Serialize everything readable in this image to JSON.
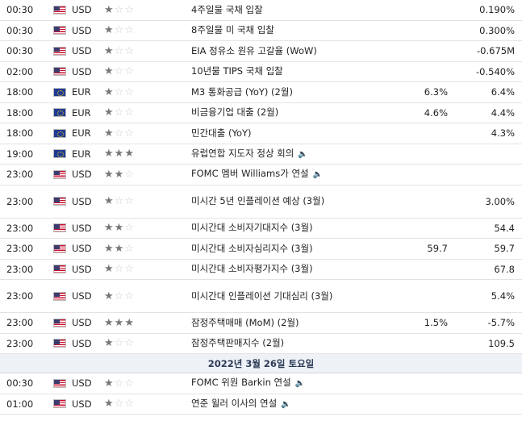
{
  "date_header": "2022년 3월 26일 토요일",
  "rows_before": [
    {
      "time": "00:30",
      "currency": "USD",
      "importance": 1,
      "event": "4주일물 국채 입찰",
      "actual": "",
      "forecast": "0.190%",
      "tall": false,
      "speech": false
    },
    {
      "time": "00:30",
      "currency": "USD",
      "importance": 1,
      "event": "8주일물 미 국채 입찰",
      "actual": "",
      "forecast": "0.300%",
      "tall": false,
      "speech": false
    },
    {
      "time": "00:30",
      "currency": "USD",
      "importance": 1,
      "event": "EIA 정유소 원유 고갈율 (WoW)",
      "actual": "",
      "forecast": "-0.675M",
      "tall": false,
      "speech": false
    },
    {
      "time": "02:00",
      "currency": "USD",
      "importance": 1,
      "event": "10년물 TIPS 국채 입찰",
      "actual": "",
      "forecast": "-0.540%",
      "tall": false,
      "speech": false
    },
    {
      "time": "18:00",
      "currency": "EUR",
      "importance": 1,
      "event": "M3 통화공급 (YoY) (2월)",
      "actual": "6.3%",
      "forecast": "6.4%",
      "tall": false,
      "speech": false
    },
    {
      "time": "18:00",
      "currency": "EUR",
      "importance": 1,
      "event": "비금융기업 대출 (2월)",
      "actual": "4.6%",
      "forecast": "4.4%",
      "tall": false,
      "speech": false
    },
    {
      "time": "18:00",
      "currency": "EUR",
      "importance": 1,
      "event": "민간대출 (YoY)",
      "actual": "",
      "forecast": "4.3%",
      "tall": false,
      "speech": false
    },
    {
      "time": "19:00",
      "currency": "EUR",
      "importance": 3,
      "event": "유럽연합 지도자 정상 회의",
      "actual": "",
      "forecast": "",
      "tall": false,
      "speech": true
    },
    {
      "time": "23:00",
      "currency": "USD",
      "importance": 2,
      "event": "FOMC 멤버 Williams가 연설",
      "actual": "",
      "forecast": "",
      "tall": false,
      "speech": true
    },
    {
      "time": "23:00",
      "currency": "USD",
      "importance": 1,
      "event": "미시간 5년 인플레이션 예상 (3월)",
      "actual": "",
      "forecast": "3.00%",
      "tall": true,
      "speech": false
    },
    {
      "time": "23:00",
      "currency": "USD",
      "importance": 2,
      "event": "미시간대 소비자기대지수 (3월)",
      "actual": "",
      "forecast": "54.4",
      "tall": false,
      "speech": false
    },
    {
      "time": "23:00",
      "currency": "USD",
      "importance": 2,
      "event": "미시간대 소비자심리지수 (3월)",
      "actual": "59.7",
      "forecast": "59.7",
      "tall": false,
      "speech": false
    },
    {
      "time": "23:00",
      "currency": "USD",
      "importance": 1,
      "event": "미시간대 소비자평가지수 (3월)",
      "actual": "",
      "forecast": "67.8",
      "tall": false,
      "speech": false
    },
    {
      "time": "23:00",
      "currency": "USD",
      "importance": 1,
      "event": "미시간대 인플레이션 기대심리 (3월)",
      "actual": "",
      "forecast": "5.4%",
      "tall": true,
      "speech": false
    },
    {
      "time": "23:00",
      "currency": "USD",
      "importance": 3,
      "event": "잠정주택매매 (MoM) (2월)",
      "actual": "1.5%",
      "forecast": "-5.7%",
      "tall": false,
      "speech": false
    },
    {
      "time": "23:00",
      "currency": "USD",
      "importance": 1,
      "event": "잠정주택판매지수 (2월)",
      "actual": "",
      "forecast": "109.5",
      "tall": false,
      "speech": false
    }
  ],
  "rows_after": [
    {
      "time": "00:30",
      "currency": "USD",
      "importance": 1,
      "event": "FOMC 위원 Barkin 연설",
      "actual": "",
      "forecast": "",
      "tall": false,
      "speech": true
    },
    {
      "time": "01:00",
      "currency": "USD",
      "importance": 1,
      "event": "연준 윌러 이사의 연설",
      "actual": "",
      "forecast": "",
      "tall": false,
      "speech": true
    }
  ]
}
